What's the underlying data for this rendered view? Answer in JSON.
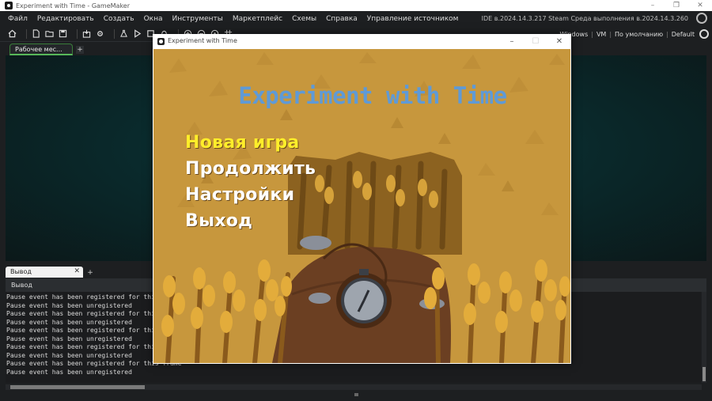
{
  "ide": {
    "window_title": "Experiment with Time - GameMaker",
    "window_controls": [
      "–",
      "❐",
      "✕"
    ],
    "menu": [
      "Файл",
      "Редактировать",
      "Создать",
      "Окна",
      "Инструменты",
      "Маркетплейс",
      "Схемы",
      "Справка",
      "Управление источником"
    ],
    "version_info": "IDE в.2024.14.3.217 Steam  Среда выполнения в.2024.14.3.260",
    "toolbar_icons": [
      "home-icon",
      "new-file-icon",
      "open-folder-icon",
      "save-icon",
      "package-icon",
      "settings-icon",
      "clean-icon",
      "run-icon",
      "stop-icon",
      "debug-icon",
      "zoom-in-icon",
      "zoom-out-icon",
      "zoom-reset-icon",
      "grid-icon"
    ],
    "target": {
      "platform": "Windows",
      "runtime": "VM",
      "config": "По умолчанию",
      "device": "Default"
    },
    "workspace_tab": "Рабочее мес...",
    "add_tab_label": "+",
    "output": {
      "tab_label": "Вывод",
      "close_label": "✕",
      "header": "Вывод",
      "lines": [
        "Pause event has been registered for this frame",
        "Pause event has been unregistered",
        "Pause event has been registered for this frame",
        "Pause event has been unregistered",
        "Pause event has been registered for this frame",
        "Pause event has been unregistered",
        "Pause event has been registered for this frame",
        "Pause event has been unregistered",
        "Pause event has been registered for this frame",
        "Pause event has been unregistered"
      ]
    }
  },
  "game": {
    "window_title": "Experiment with Time",
    "window_controls": [
      "–",
      "☐",
      "✕"
    ],
    "title": "Experiment with Time",
    "menu": [
      {
        "label": "Новая игра",
        "selected": true
      },
      {
        "label": "Продолжить",
        "selected": false
      },
      {
        "label": "Настройки",
        "selected": false
      },
      {
        "label": "Выход",
        "selected": false
      }
    ],
    "colors": {
      "title": "#5f9ad6",
      "selected": "#ffee2a",
      "option": "#ffffff",
      "background": "#c99a3e",
      "soil": "#6b3f22",
      "wheat": "#e0a93a"
    }
  }
}
